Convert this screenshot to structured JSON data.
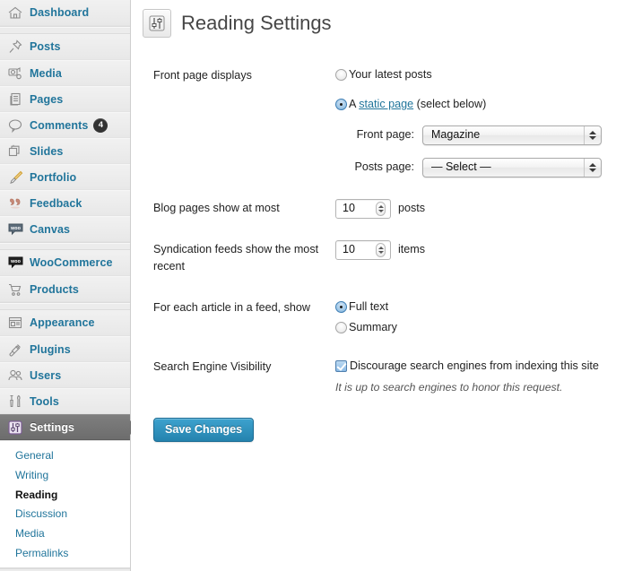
{
  "sidebar": {
    "groups": [
      {
        "items": [
          {
            "icon": "dashboard-icon",
            "label": "Dashboard"
          }
        ]
      },
      {
        "items": [
          {
            "icon": "pin-icon",
            "label": "Posts"
          },
          {
            "icon": "camera-icon",
            "label": "Media"
          },
          {
            "icon": "pages-icon",
            "label": "Pages"
          },
          {
            "icon": "comment-icon",
            "label": "Comments",
            "badge": "4"
          },
          {
            "icon": "slides-icon",
            "label": "Slides"
          },
          {
            "icon": "brush-icon",
            "label": "Portfolio"
          },
          {
            "icon": "feedback-icon",
            "label": "Feedback"
          },
          {
            "icon": "woo-canvas-icon",
            "label": "Canvas"
          }
        ]
      },
      {
        "items": [
          {
            "icon": "woocommerce-icon",
            "label": "WooCommerce"
          },
          {
            "icon": "cart-icon",
            "label": "Products"
          }
        ]
      },
      {
        "items": [
          {
            "icon": "appearance-icon",
            "label": "Appearance"
          },
          {
            "icon": "plugins-icon",
            "label": "Plugins"
          },
          {
            "icon": "users-icon",
            "label": "Users"
          },
          {
            "icon": "tools-icon",
            "label": "Tools"
          },
          {
            "icon": "settings-icon",
            "label": "Settings",
            "active": true
          }
        ]
      }
    ],
    "submenu": {
      "items": [
        {
          "label": "General"
        },
        {
          "label": "Writing"
        },
        {
          "label": "Reading",
          "current": true
        },
        {
          "label": "Discussion"
        },
        {
          "label": "Media"
        },
        {
          "label": "Permalinks"
        }
      ]
    }
  },
  "page": {
    "title": "Reading Settings",
    "title_icon": "settings-sliders-icon"
  },
  "form": {
    "front_page": {
      "label": "Front page displays",
      "options": [
        {
          "label": "Your latest posts",
          "checked": false
        },
        {
          "label_prefix": "A ",
          "link": "static page",
          "label_suffix": " (select below)",
          "checked": true
        }
      ],
      "front_page_select": {
        "label": "Front page:",
        "value": "Magazine"
      },
      "posts_page_select": {
        "label": "Posts page:",
        "value": "— Select —"
      }
    },
    "blog_pages": {
      "label": "Blog pages show at most",
      "value": "10",
      "unit": "posts"
    },
    "syndication": {
      "label": "Syndication feeds show the most recent",
      "value": "10",
      "unit": "items"
    },
    "feed_article": {
      "label": "For each article in a feed, show",
      "options": [
        {
          "label": "Full text",
          "checked": true
        },
        {
          "label": "Summary",
          "checked": false
        }
      ]
    },
    "search_visibility": {
      "label": "Search Engine Visibility",
      "checkbox_label": "Discourage search engines from indexing this site",
      "checked": true,
      "hint": "It is up to search engines to honor this request."
    },
    "submit": {
      "label": "Save Changes"
    }
  },
  "colors": {
    "link": "#21759b",
    "active_bg": "#6d6d6d",
    "button": "#2583ae",
    "sidebar_bg": "#ececec"
  }
}
